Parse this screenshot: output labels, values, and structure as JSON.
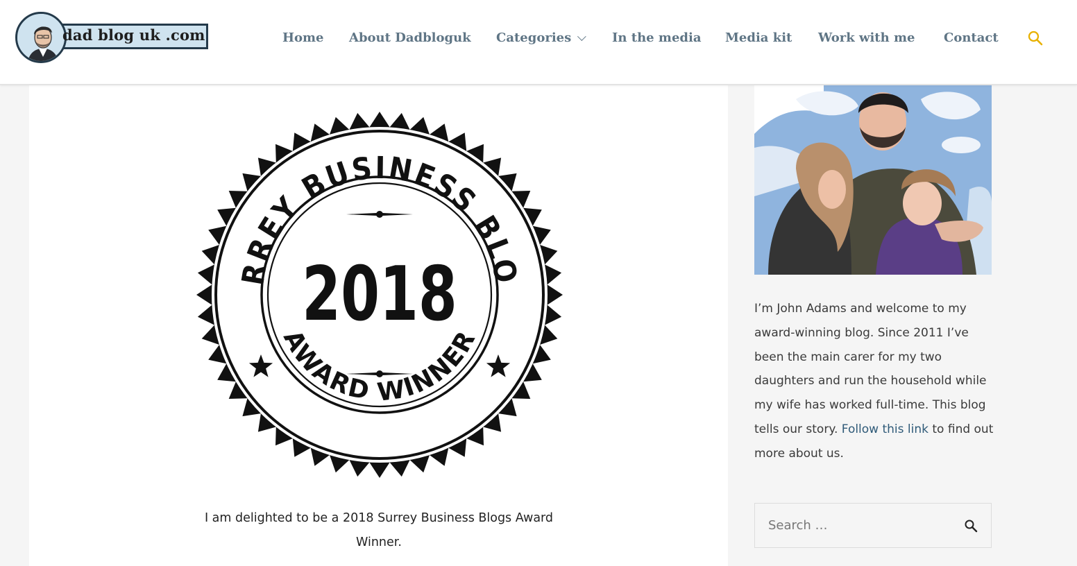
{
  "header": {
    "logo_text": "dad blog uk .com",
    "nav": [
      {
        "label": "Home"
      },
      {
        "label": "About Dadbloguk"
      },
      {
        "label": "Categories"
      },
      {
        "label": "In the media"
      },
      {
        "label": "Media kit"
      },
      {
        "label": "Work with me"
      },
      {
        "label": "Contact"
      }
    ],
    "search_icon": "search-icon",
    "accent": "#e8b100",
    "nav_color": "#5f7585"
  },
  "main": {
    "badge": {
      "top_text": "SURREY BUSINESS BLOGS",
      "year": "2018",
      "bottom_text": "AWARD WINNER"
    },
    "caption": "I am delighted to be a 2018 Surrey Business Blogs Award Winner."
  },
  "sidebar": {
    "about_before_link": "I’m John Adams and welcome to my award-winning blog. Since 2011 I’ve been the main carer for my two daughters and run the household while my wife has worked full-time. This blog tells our story. ",
    "about_link": "Follow this link",
    "about_after_link": " to find out more about us.",
    "search_placeholder": "Search …",
    "search_icon": "search-icon"
  }
}
